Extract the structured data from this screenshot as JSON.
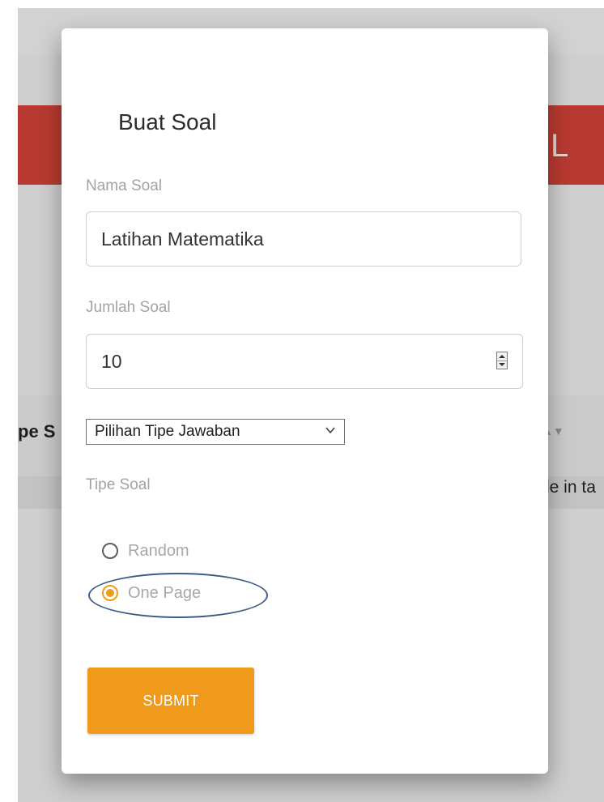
{
  "background": {
    "header_partial_text": "L",
    "column_partial_label": "pe S",
    "empty_partial_text": "le in ta"
  },
  "modal": {
    "title": "Buat Soal",
    "fields": {
      "nama_soal": {
        "label": "Nama Soal",
        "value": "Latihan Matematika"
      },
      "jumlah_soal": {
        "label": "Jumlah Soal",
        "value": "10"
      },
      "tipe_jawaban": {
        "selected": "Pilihan Tipe Jawaban"
      },
      "tipe_soal": {
        "label": "Tipe Soal",
        "options": [
          {
            "label": "Random",
            "checked": false
          },
          {
            "label": "One Page",
            "checked": true
          }
        ]
      }
    },
    "submit_label": "SUBMIT"
  },
  "colors": {
    "accent": "#f09a1b",
    "header_red": "#b93a31",
    "annotation": "#3b5e85"
  },
  "icons": {
    "spinner": "spinner-icon",
    "select": "chevron-down-icon",
    "sort": "sort-icon"
  }
}
